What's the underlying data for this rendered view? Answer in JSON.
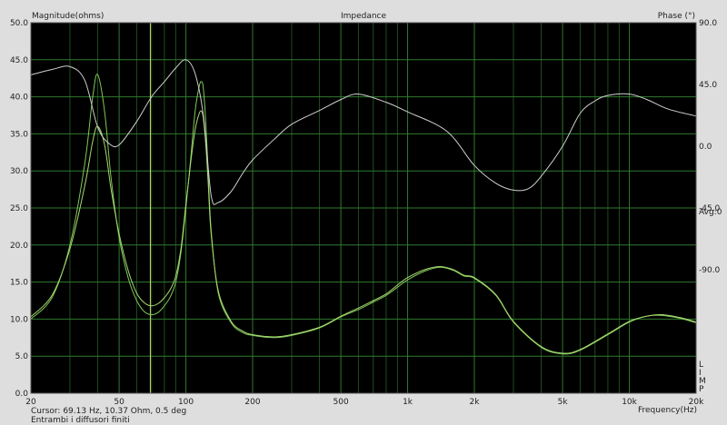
{
  "chart_data": {
    "type": "line",
    "title": "Impedance",
    "ylabel_left": "Magnitude(ohms)",
    "ylabel_right": "Phase (°)",
    "xlabel": "Frequency(Hz)",
    "x_scale": "log",
    "xlim": [
      20,
      20000
    ],
    "ylim_left": [
      0,
      50
    ],
    "ylim_right": [
      -180,
      90
    ],
    "x_ticks": [
      {
        "v": 20,
        "label": "20"
      },
      {
        "v": 50,
        "label": "50"
      },
      {
        "v": 100,
        "label": "100"
      },
      {
        "v": 200,
        "label": "200"
      },
      {
        "v": 500,
        "label": "500"
      },
      {
        "v": 1000,
        "label": "1k"
      },
      {
        "v": 2000,
        "label": "2k"
      },
      {
        "v": 5000,
        "label": "5k"
      },
      {
        "v": 10000,
        "label": "10k"
      },
      {
        "v": 20000,
        "label": "20k"
      }
    ],
    "y_ticks_left": [
      "50.0",
      "45.0",
      "40.0",
      "35.0",
      "30.0",
      "25.0",
      "20.0",
      "15.0",
      "10.0",
      "5.0",
      "0.0"
    ],
    "y_ticks_right": [
      {
        "v": 90,
        "label": "90.0"
      },
      {
        "v": 45,
        "label": "45.0"
      },
      {
        "v": 0,
        "label": "0.0"
      },
      {
        "v": -45,
        "label": "-45.0"
      },
      {
        "v": -90,
        "label": "-90.0"
      }
    ],
    "avg_label": "Avg:0",
    "cursor_freq": 69.13,
    "grid": true,
    "series": [
      {
        "axis": "left",
        "color": "#7ec85a",
        "x": [
          20,
          25,
          30,
          35,
          38,
          40,
          43,
          46,
          50,
          55,
          60,
          65,
          70,
          75,
          80,
          85,
          90,
          95,
          100,
          105,
          110,
          115,
          118,
          120,
          123,
          126,
          130,
          140,
          160,
          180,
          200,
          250,
          300,
          400,
          500,
          600,
          700,
          800,
          900,
          1000,
          1200,
          1400,
          1600,
          1800,
          2000,
          2500,
          3000,
          4000,
          5000,
          6000,
          8000,
          10000,
          12000,
          14000,
          17000,
          20000
        ],
        "y": [
          10.0,
          13.0,
          20.0,
          31.0,
          40.0,
          43.0,
          38.0,
          29.0,
          21.0,
          15.5,
          12.5,
          11.0,
          10.6,
          10.9,
          11.8,
          13.0,
          15.0,
          19.0,
          25.0,
          31.5,
          38.0,
          41.5,
          42.0,
          41.0,
          36.5,
          30.0,
          22.0,
          13.5,
          9.5,
          8.2,
          7.8,
          7.5,
          7.8,
          8.8,
          10.3,
          11.3,
          12.3,
          13.2,
          14.3,
          15.3,
          16.5,
          17.0,
          16.6,
          15.8,
          15.5,
          13.2,
          9.6,
          6.2,
          5.3,
          5.8,
          7.9,
          9.6,
          10.4,
          10.5,
          10.1,
          9.5
        ]
      },
      {
        "axis": "left",
        "color": "#a8d86f",
        "x": [
          20,
          25,
          30,
          35,
          38,
          40,
          43,
          46,
          50,
          55,
          60,
          65,
          70,
          75,
          80,
          85,
          90,
          95,
          100,
          105,
          110,
          115,
          118,
          120,
          123,
          126,
          130,
          140,
          160,
          180,
          200,
          250,
          300,
          400,
          500,
          600,
          700,
          800,
          900,
          1000,
          1200,
          1400,
          1600,
          1800,
          2000,
          2500,
          3000,
          4000,
          5000,
          6000,
          8000,
          10000,
          12000,
          14000,
          17000,
          20000
        ],
        "y": [
          10.3,
          13.3,
          19.5,
          28.0,
          34.0,
          36.0,
          33.5,
          27.5,
          21.5,
          16.5,
          13.5,
          12.2,
          11.8,
          12.1,
          12.9,
          14.0,
          15.8,
          19.5,
          25.5,
          31.0,
          35.5,
          37.8,
          38.0,
          37.0,
          33.5,
          28.5,
          21.5,
          13.8,
          9.7,
          8.4,
          7.9,
          7.6,
          7.9,
          8.9,
          10.4,
          11.5,
          12.5,
          13.4,
          14.6,
          15.6,
          16.7,
          17.1,
          16.7,
          15.9,
          15.6,
          13.3,
          9.7,
          6.3,
          5.4,
          5.9,
          8.0,
          9.7,
          10.4,
          10.6,
          10.2,
          9.6
        ]
      },
      {
        "axis": "right",
        "color": "#cfcfcf",
        "x": [
          20,
          25,
          30,
          35,
          40,
          45,
          50,
          60,
          70,
          80,
          90,
          100,
          110,
          120,
          130,
          140,
          160,
          180,
          200,
          250,
          300,
          400,
          500,
          600,
          800,
          1000,
          1500,
          2000,
          2500,
          3000,
          3500,
          4000,
          5000,
          6000,
          7000,
          8000,
          10000,
          12000,
          15000,
          20000
        ],
        "y": [
          52,
          56,
          58,
          48,
          14,
          2,
          1,
          18,
          36,
          47,
          57,
          63,
          53,
          22,
          -36,
          -41,
          -33,
          -20,
          -10,
          5,
          16,
          26,
          34,
          38,
          32,
          25,
          11,
          -14,
          -27,
          -32,
          -31,
          -22,
          0,
          24,
          33,
          37,
          38,
          34,
          27,
          22
        ]
      }
    ]
  },
  "cursor_text": "Cursor: 69.13 Hz, 10.37 Ohm, 0.5 deg",
  "caption": "Entrambi i diffusori finiti",
  "side_letters": [
    "L",
    "I",
    "M",
    "P"
  ]
}
